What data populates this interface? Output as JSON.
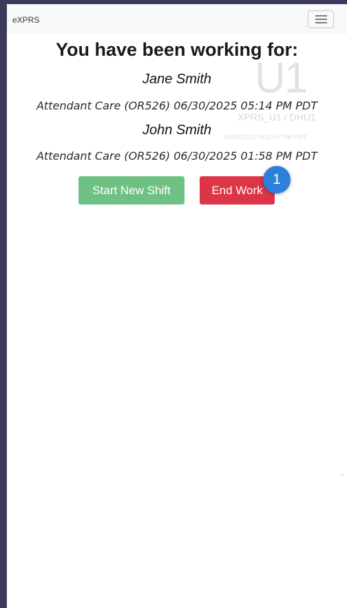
{
  "navbar": {
    "brand": "eXPRS",
    "menu_icon": "hamburger-menu-icon"
  },
  "watermark": {
    "big": "U1",
    "sub": "XPRS_U1 / DHU1",
    "time": "06/30/2025 05:20:47 PM PDT"
  },
  "main": {
    "title": "You have been working for:",
    "clients": [
      {
        "name": "Jane Smith",
        "detail": "Attendant Care (OR526) 06/30/2025 05:14 PM PDT"
      },
      {
        "name": "John Smith",
        "detail": "Attendant Care (OR526) 06/30/2025 01:58 PM PDT"
      }
    ],
    "start_shift_label": "Start New Shift",
    "end_work_label": "End Work"
  },
  "annotation": {
    "badge": "1"
  },
  "colors": {
    "frame_border": "#3b3a5c",
    "navbar_bg": "#f8f9fa",
    "start_button": "#6fc183",
    "end_button": "#dc3545",
    "badge": "#2d7fdd"
  }
}
